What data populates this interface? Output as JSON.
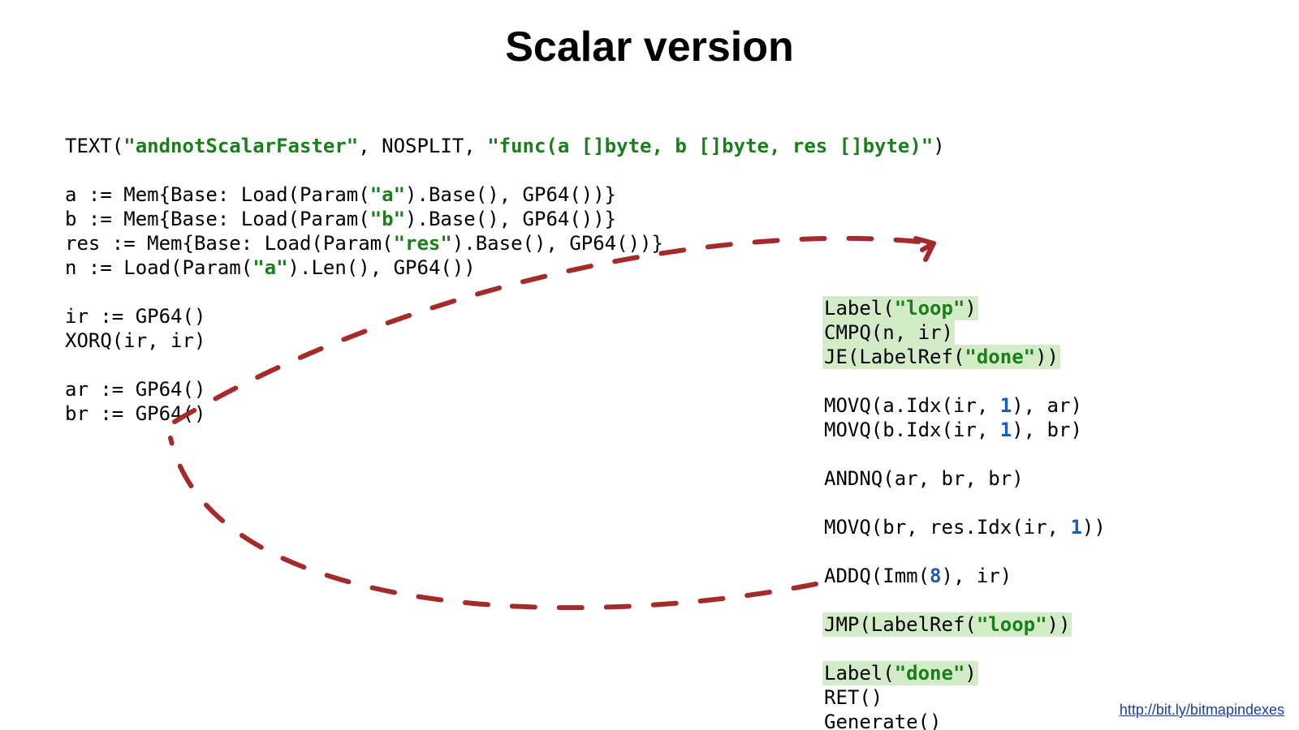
{
  "title": "Scalar version",
  "footer_link": "http://bit.ly/bitmapindexes",
  "strings": {
    "fnname": "\"andnotScalarFaster\"",
    "sig": "\"func(a []byte, b []byte, res []byte)\"",
    "a": "\"a\"",
    "b": "\"b\"",
    "res": "\"res\"",
    "loop": "\"loop\"",
    "done": "\"done\""
  },
  "nums": {
    "one_a": "1",
    "one_b": "1",
    "one_c": "1",
    "eight": "8"
  },
  "left": {
    "l1a": "TEXT(",
    "l1b": ", NOSPLIT, ",
    "l1c": ")",
    "l2": "",
    "l3a": "a := Mem{Base: Load(Param(",
    "l3b": ").Base(), GP64())}",
    "l4a": "b := Mem{Base: Load(Param(",
    "l4b": ").Base(), GP64())}",
    "l5a": "res := Mem{Base: Load(Param(",
    "l5b": ").Base(), GP64())}",
    "l6a": "n := Load(Param(",
    "l6b": ").Len(), GP64())",
    "l7": "",
    "l8": "ir := GP64()",
    "l9": "XORQ(ir, ir)",
    "l10": "",
    "l11": "ar := GP64()",
    "l12": "br := GP64()"
  },
  "right": {
    "r1a": "Label(",
    "r1b": ")",
    "r2": "CMPQ(n, ir)",
    "r3a": "JE(LabelRef(",
    "r3b": "))",
    "r4": "",
    "r5a": "MOVQ(a.Idx(ir, ",
    "r5b": "), ar)",
    "r6a": "MOVQ(b.Idx(ir, ",
    "r6b": "), br)",
    "r7": "",
    "r8": "ANDNQ(ar, br, br)",
    "r9": "",
    "r10a": "MOVQ(br, res.Idx(ir, ",
    "r10b": "))",
    "r11": "",
    "r12a": "ADDQ(Imm(",
    "r12b": "), ir)",
    "r13": "",
    "r14a": "JMP(LabelRef(",
    "r14b": "))",
    "r15": "",
    "r16a": "Label(",
    "r16b": ")",
    "r17": "RET()",
    "r18": "Generate()"
  }
}
